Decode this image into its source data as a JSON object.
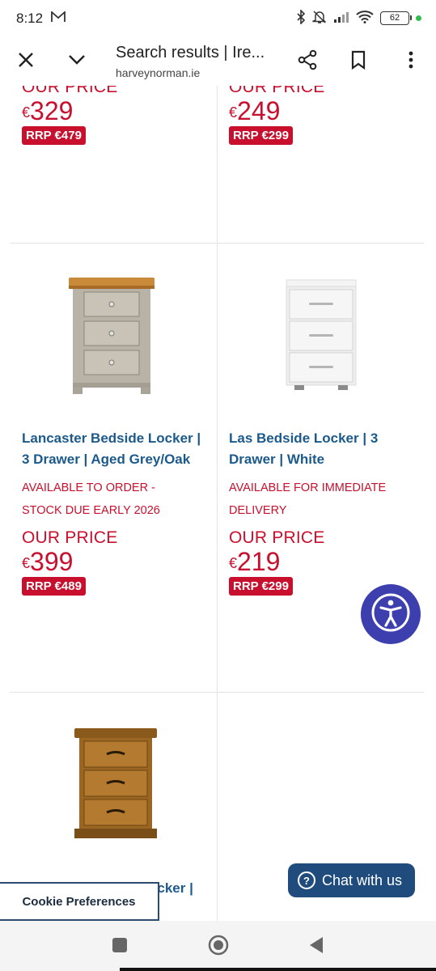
{
  "status_bar": {
    "time": "8:12",
    "mail_icon": "gmail-icon",
    "battery": "62"
  },
  "toolbar": {
    "title": "Search results | Ire...",
    "url": "harveynorman.ie"
  },
  "products": [
    {
      "name": "",
      "availability": "",
      "price_label": "OUR PRICE",
      "currency": "€",
      "price": "329",
      "rrp": "RRP €479"
    },
    {
      "name": "",
      "availability": "",
      "price_label": "OUR PRICE",
      "currency": "€",
      "price": "249",
      "rrp": "RRP €299"
    },
    {
      "name_line1": "Lancaster Bedside Locker |",
      "name_line2": "3 Drawer | Aged Grey/Oak",
      "availability_line1": "AVAILABLE TO ORDER -",
      "availability_line2": "STOCK DUE EARLY 2026",
      "price_label": "OUR PRICE",
      "currency": "€",
      "price": "399",
      "rrp": "RRP €489"
    },
    {
      "name_line1": "Las Bedside Locker | 3",
      "name_line2": "Drawer | White",
      "availability_line1": "AVAILABLE FOR IMMEDIATE",
      "availability_line2": "DELIVERY",
      "price_label": "OUR PRICE",
      "currency": "€",
      "price": "219",
      "rrp": "RRP €299"
    },
    {
      "name_partial_right": "ocker |"
    }
  ],
  "chat": {
    "label": "Chat with us"
  },
  "cookie": {
    "label": "Cookie Preferences"
  },
  "colors": {
    "price_red": "#c8102e",
    "link_blue": "#1c5a8c",
    "a11y_purple": "#3d3fae",
    "chat_navy": "#1f4c7c"
  }
}
